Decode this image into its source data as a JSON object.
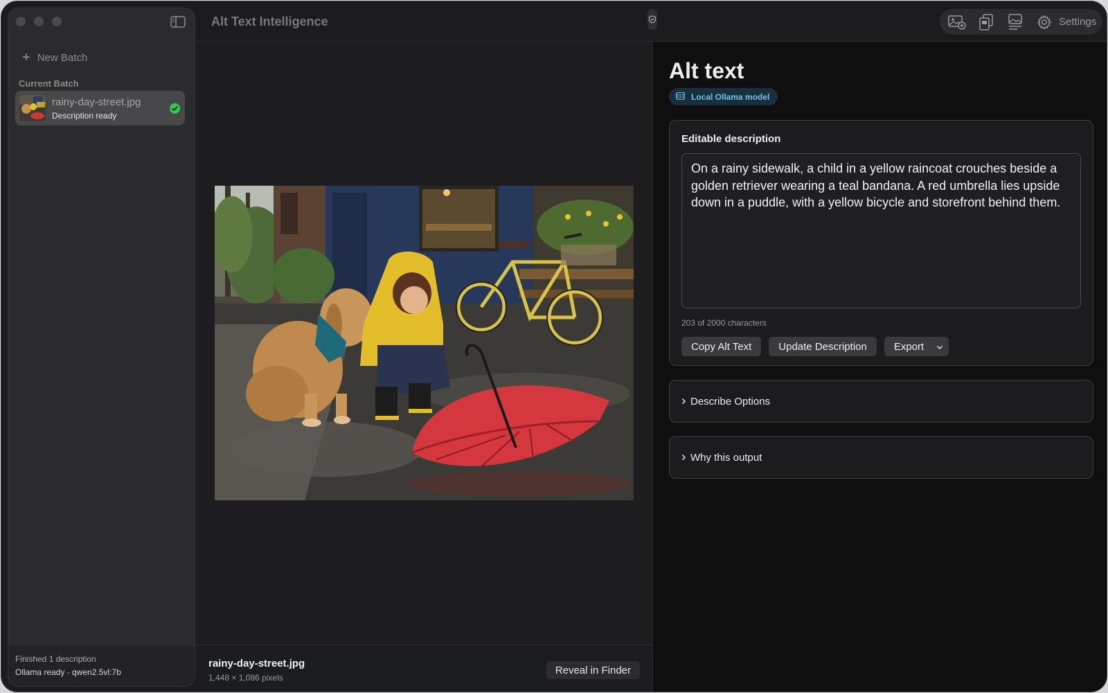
{
  "app": {
    "title": "Alt Text Intelligence"
  },
  "sidebar": {
    "new_batch_label": "New Batch",
    "section_label": "Current Batch",
    "items": [
      {
        "name": "rainy-day-street.jpg",
        "status": "Description ready"
      }
    ],
    "footer": {
      "status": "Finished 1 description",
      "model": "Ollama ready · qwen2.5vl:7b"
    }
  },
  "toolbar": {
    "icons": [
      "add-image-icon",
      "copy-document-icon",
      "image-caption-icon",
      "gear-icon"
    ],
    "settings_label": "Settings"
  },
  "preview": {
    "file_name": "rainy-day-street.jpg",
    "dimensions": "1,448 × 1,086 pixels",
    "reveal_label": "Reveal in Finder"
  },
  "alt_panel": {
    "title": "Alt text",
    "model_badge": "Local Ollama model",
    "editor_title": "Editable description",
    "description": "On a rainy sidewalk, a child in a yellow raincoat crouches beside a golden retriever wearing a teal bandana. A red umbrella lies upside down in a puddle, with a yellow bicycle and storefront behind them.",
    "char_count": "203 of 2000 characters",
    "buttons": {
      "copy": "Copy Alt Text",
      "update": "Update Description",
      "export": "Export"
    },
    "sections": [
      {
        "label": "Describe Options"
      },
      {
        "label": "Why this output"
      }
    ]
  },
  "colors": {
    "accent": "#6fc2ee",
    "success": "#34c759",
    "background": "#0f0f10"
  }
}
